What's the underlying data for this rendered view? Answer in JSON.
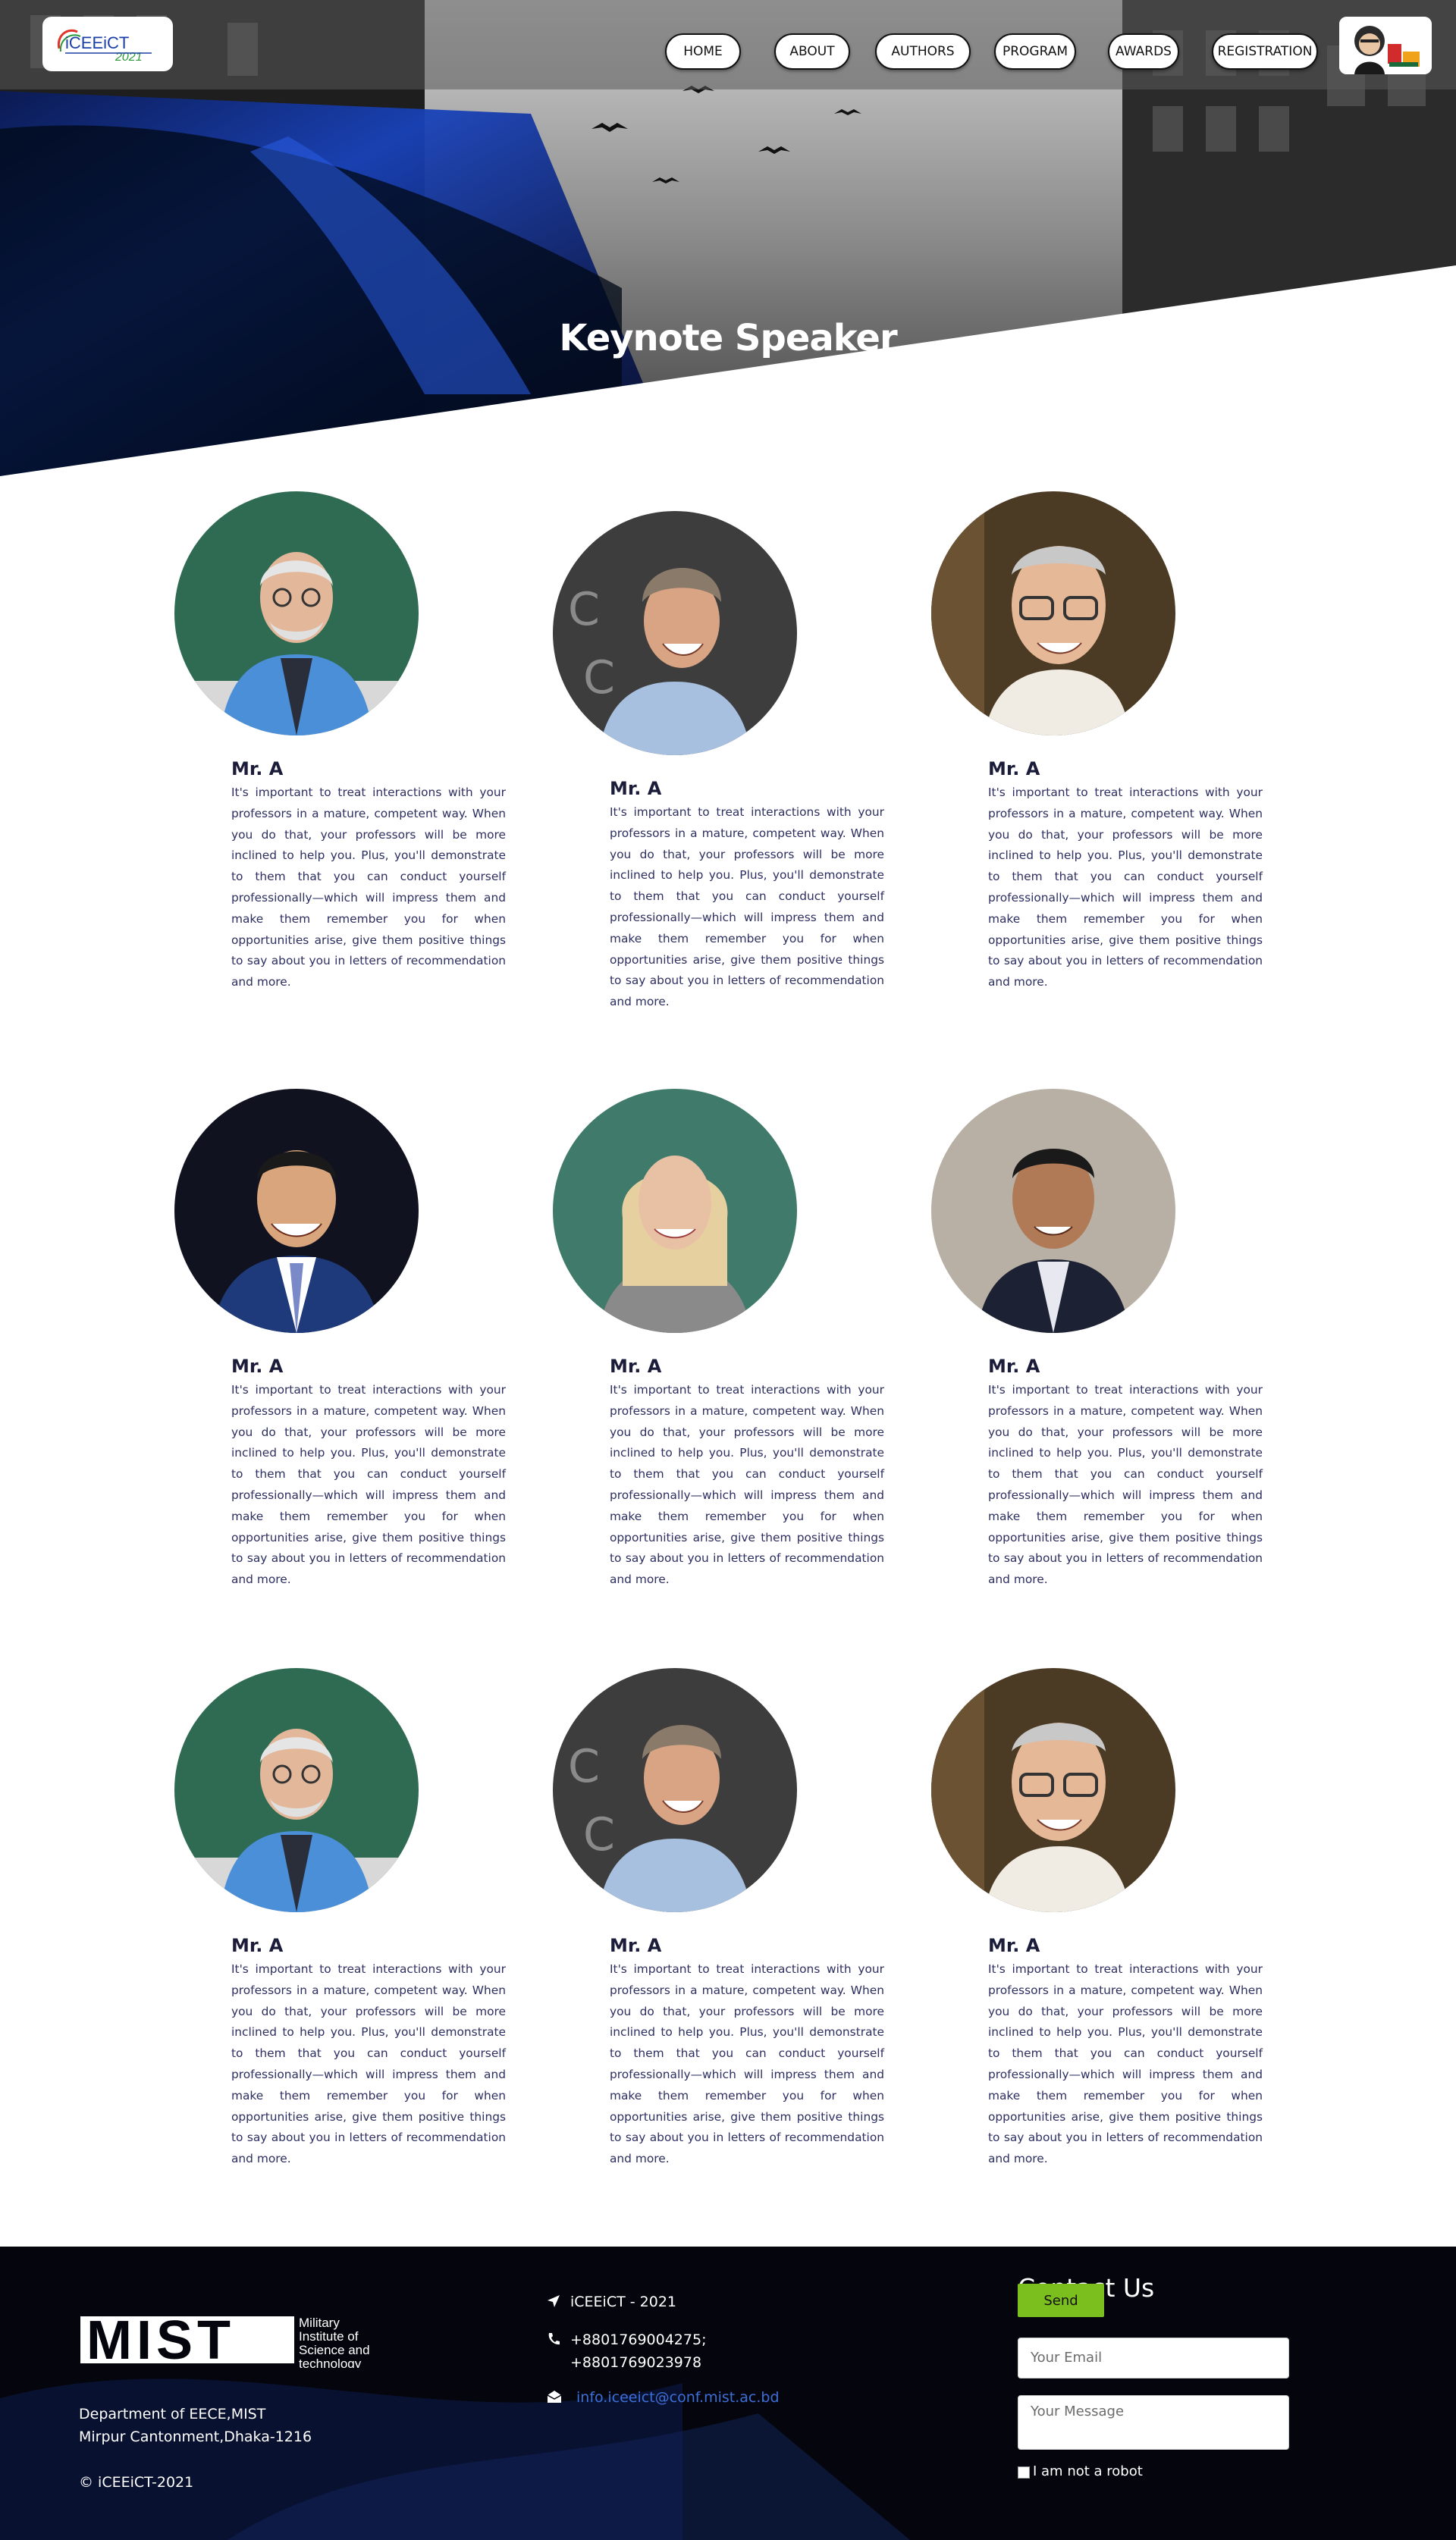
{
  "nav": {
    "logo_text": "iCEEiCT",
    "logo_year": "2021",
    "items": [
      {
        "label": "HOME"
      },
      {
        "label": "ABOUT"
      },
      {
        "label": "AUTHORS"
      },
      {
        "label": "PROGRAM"
      },
      {
        "label": "AWARDS"
      },
      {
        "label": "REGISTRATION"
      }
    ]
  },
  "hero": {
    "title": "Keynote Speaker"
  },
  "speakers": [
    {
      "name": "Mr. A",
      "bio": "It's important to treat interactions with your professors in a mature, competent way. When you do that, your professors will be more inclined to help you. Plus, you'll demonstrate to them that you can conduct yourself professionally—which will impress them and make them remember you for when opportunities arise, give them positive things to say about you in letters of recommendation and more."
    },
    {
      "name": "Mr. A",
      "bio": "It's important to treat interactions with your professors in a mature, competent way. When you do that, your professors will be more inclined to help you. Plus, you'll demonstrate to them that you can conduct yourself professionally—which will impress them and make them remember you for when opportunities arise, give them positive things to say about you in letters of recommendation and more."
    },
    {
      "name": "Mr. A",
      "bio": "It's important to treat interactions with your professors in a mature, competent way. When you do that, your professors will be more inclined to help you. Plus, you'll demonstrate to them that you can conduct yourself professionally—which will impress them and make them remember you for when opportunities arise, give them positive things to say about you in letters of recommendation and more."
    },
    {
      "name": "Mr. A",
      "bio": "It's important to treat interactions with your professors in a mature, competent way. When you do that, your professors will be more inclined to help you. Plus, you'll demonstrate to them that you can conduct yourself professionally—which will impress them and make them remember you for when opportunities arise, give them positive things to say about you in letters of recommendation and more."
    },
    {
      "name": "Mr. A",
      "bio": "It's important to treat interactions with your professors in a mature, competent way. When you do that, your professors will be more inclined to help you. Plus, you'll demonstrate to them that you can conduct yourself professionally—which will impress them and make them remember you for when opportunities arise, give them positive things to say about you in letters of recommendation and more."
    },
    {
      "name": "Mr. A",
      "bio": "It's important to treat interactions with your professors in a mature, competent way. When you do that, your professors will be more inclined to help you. Plus, you'll demonstrate to them that you can conduct yourself professionally—which will impress them and make them remember you for when opportunities arise, give them positive things to say about you in letters of recommendation and more."
    },
    {
      "name": "Mr. A",
      "bio": "It's important to treat interactions with your professors in a mature, competent way. When you do that, your professors will be more inclined to help you. Plus, you'll demonstrate to them that you can conduct yourself professionally—which will impress them and make them remember you for when opportunities arise, give them positive things to say about you in letters of recommendation and more."
    },
    {
      "name": "Mr. A",
      "bio": "It's important to treat interactions with your professors in a mature, competent way. When you do that, your professors will be more inclined to help you. Plus, you'll demonstrate to them that you can conduct yourself professionally—which will impress them and make them remember you for when opportunities arise, give them positive things to say about you in letters of recommendation and more."
    },
    {
      "name": "Mr. A",
      "bio": "It's important to treat interactions with your professors in a mature, competent way. When you do that, your professors will be more inclined to help you. Plus, you'll demonstrate to them that you can conduct yourself professionally—which will impress them and make them remember you for when opportunities arise, give them positive things to say about you in letters of recommendation and more."
    }
  ],
  "footer": {
    "mist_wordmark": "MIST",
    "mist_tagline_1": "Military",
    "mist_tagline_2": "Institute of",
    "mist_tagline_3": "Science and",
    "mist_tagline_4": "technology",
    "address_line_1": "Department of EECE,MIST",
    "address_line_2": "Mirpur Cantonment,Dhaka-1216",
    "copyright": "© iCEEiCT-2021",
    "location": "iCEEiCT - 2021",
    "phone_1": "+8801769004275;",
    "phone_2": "+8801769023978",
    "email": "info.iceeict@conf.mist.ac.bd",
    "contact_title": "Contact Us",
    "email_placeholder": "Your Email",
    "message_placeholder": "Your Message",
    "captcha_label": "I am not a robot",
    "send_label": "Send"
  },
  "colors": {
    "accent_blue": "#1d3fa8",
    "send_green": "#7bbf1f",
    "link_blue": "#3b6fd9",
    "text_navy": "#1a1c3a"
  }
}
